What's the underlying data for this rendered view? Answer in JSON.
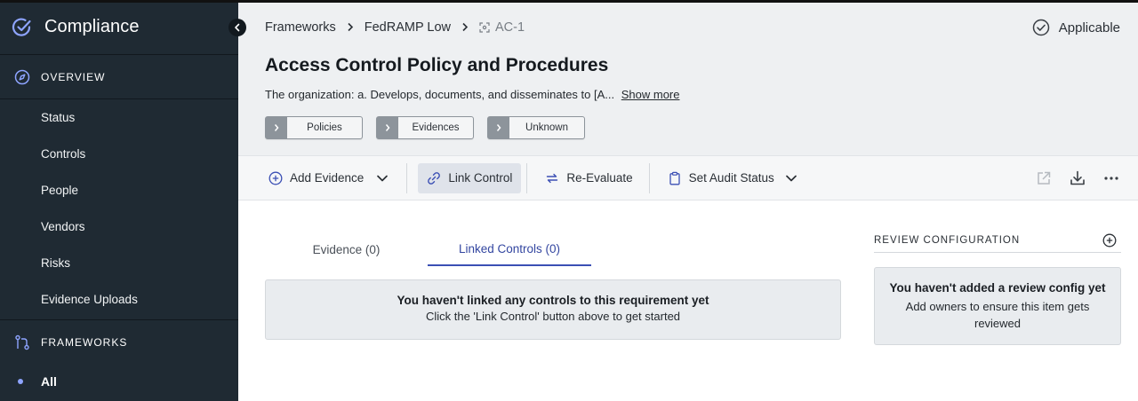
{
  "app": {
    "title": "Compliance"
  },
  "sidebar": {
    "overview_label": "OVERVIEW",
    "items": [
      {
        "label": "Status"
      },
      {
        "label": "Controls"
      },
      {
        "label": "People"
      },
      {
        "label": "Vendors"
      },
      {
        "label": "Risks"
      },
      {
        "label": "Evidence Uploads"
      }
    ],
    "frameworks_label": "FRAMEWORKS",
    "frameworks_items": [
      {
        "label": "All",
        "selected": true
      }
    ]
  },
  "breadcrumb": {
    "items": [
      "Frameworks",
      "FedRAMP Low",
      "AC-1"
    ]
  },
  "status": {
    "label": "Applicable"
  },
  "page": {
    "title": "Access Control Policy and Procedures",
    "description": "The organization: a. Develops, documents, and disseminates to [A...",
    "show_more": "Show more"
  },
  "tags": [
    {
      "label": "Policies"
    },
    {
      "label": "Evidences"
    },
    {
      "label": "Unknown"
    }
  ],
  "toolbar": {
    "add_evidence": "Add Evidence",
    "link_control": "Link Control",
    "re_evaluate": "Re-Evaluate",
    "set_audit_status": "Set Audit Status"
  },
  "tabs": [
    {
      "label": "Evidence (0)",
      "active": false
    },
    {
      "label": "Linked Controls (0)",
      "active": true
    }
  ],
  "empty_state": {
    "heading": "You haven't linked any controls to this requirement yet",
    "subtext": "Click the 'Link Control' button above to get started"
  },
  "review": {
    "header": "REVIEW CONFIGURATION",
    "heading": "You haven't added a review config yet",
    "subtext": "Add owners to ensure this item gets reviewed"
  },
  "colors": {
    "sidebar_bg": "#1f2a33",
    "accent": "#3b4fb4",
    "header_bg": "#eef0f2"
  }
}
